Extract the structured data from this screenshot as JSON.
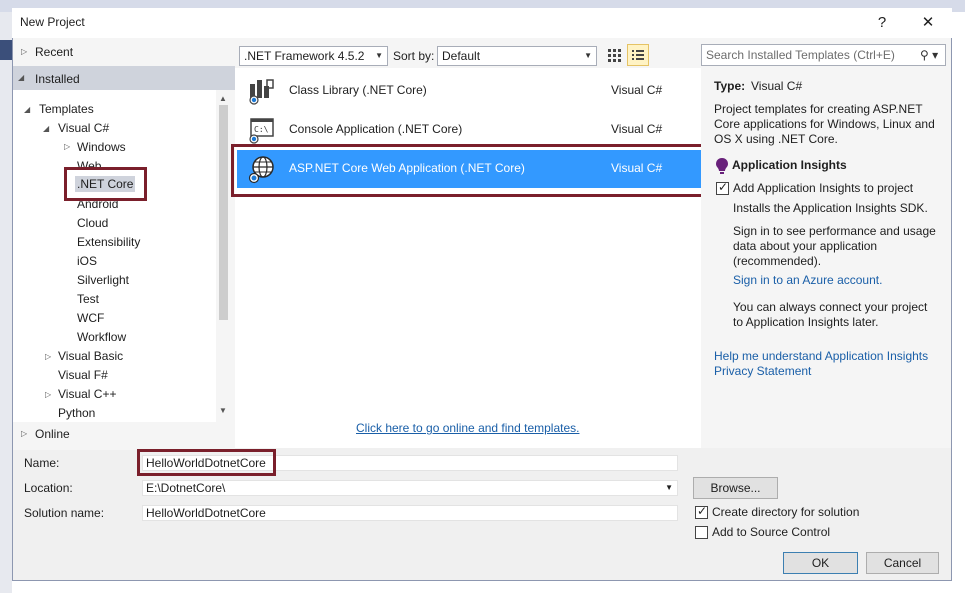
{
  "window": {
    "title": "New Project",
    "help_glyph": "?",
    "close_glyph": "✕"
  },
  "nav": {
    "recent": "Recent",
    "installed": "Installed",
    "online": "Online",
    "tree": [
      {
        "label": "Templates"
      },
      {
        "label": "Visual C#"
      },
      {
        "label": "Windows"
      },
      {
        "label": "Web"
      },
      {
        "label": ".NET Core",
        "selected": true
      },
      {
        "label": "Android"
      },
      {
        "label": "Cloud"
      },
      {
        "label": "Extensibility"
      },
      {
        "label": "iOS"
      },
      {
        "label": "Silverlight"
      },
      {
        "label": "Test"
      },
      {
        "label": "WCF"
      },
      {
        "label": "Workflow"
      },
      {
        "label": "Visual Basic"
      },
      {
        "label": "Visual F#"
      },
      {
        "label": "Visual C++"
      },
      {
        "label": "Python"
      }
    ]
  },
  "toolbar": {
    "framework": ".NET Framework 4.5.2",
    "sort_label": "Sort by:",
    "sort_value": "Default",
    "search_placeholder": "Search Installed Templates (Ctrl+E)"
  },
  "templates": [
    {
      "name": "Class Library (.NET Core)",
      "lang": "Visual C#",
      "icon": "class-library-icon"
    },
    {
      "name": "Console Application (.NET Core)",
      "lang": "Visual C#",
      "icon": "console-app-icon"
    },
    {
      "name": "ASP.NET Core Web Application (.NET Core)",
      "lang": "Visual C#",
      "icon": "web-globe-icon",
      "selected": true
    }
  ],
  "online_link": "Click here to go online and find templates.",
  "details": {
    "type_label": "Type:",
    "type_value": "Visual C#",
    "description": "Project templates for creating ASP.NET Core applications for Windows, Linux and OS X using .NET Core.",
    "ai_heading": "Application Insights",
    "ai_checkbox": "Add Application Insights to project",
    "ai_install": "Installs the Application Insights SDK.",
    "ai_signin_text": "Sign in to see performance and usage data about your application (recommended).",
    "ai_signin_link": "Sign in to an Azure account.",
    "ai_later": "You can always connect your project to Application Insights later.",
    "help_link": "Help me understand Application Insights",
    "privacy_link": "Privacy Statement"
  },
  "form": {
    "name_label": "Name:",
    "name_value": "HelloWorldDotnetCore",
    "location_label": "Location:",
    "location_value": "E:\\DotnetCore\\",
    "solution_label": "Solution name:",
    "solution_value": "HelloWorldDotnetCore",
    "browse": "Browse...",
    "create_dir": "Create directory for solution",
    "create_dir_checked": true,
    "source_control": "Add to Source Control",
    "source_control_checked": false,
    "ok": "OK",
    "cancel": "Cancel"
  },
  "colors": {
    "selection": "#3399ff",
    "highlight_box": "#7a1f2b",
    "link": "#1a5fa8"
  }
}
